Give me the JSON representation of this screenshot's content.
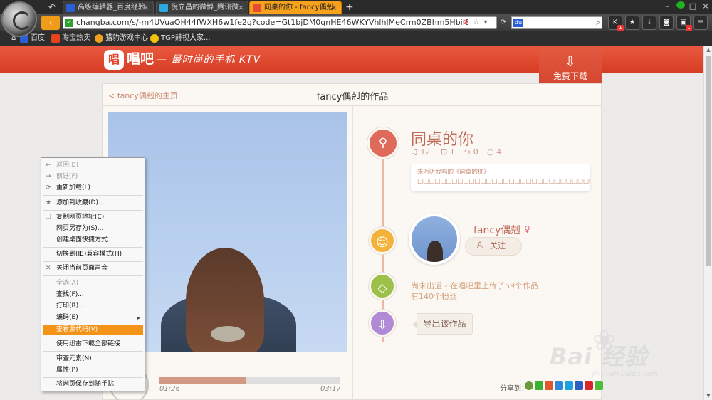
{
  "browser": {
    "tabs": [
      {
        "label": "高级编辑器_百度经验",
        "active": false
      },
      {
        "label": "倪立昌的微博_腾讯微...",
        "active": false
      },
      {
        "label": "同桌的你 - fancy偶剋",
        "active": true
      }
    ],
    "new_tab_icon": "+",
    "url": "changba.com/s/-m4UVuaOH44fWXH6w1fe2g?code=Gt1bjDM0qnHE46WKYVhlhJMeCrm0ZBhm5HbiI8KM4cUT",
    "bookmarks": [
      "百度",
      "淘宝热卖",
      "猎豹游戏中心",
      "TGP赫视大家..."
    ],
    "badge_count": "1"
  },
  "site": {
    "brand_logo": "唱",
    "brand_name": "唱吧",
    "slogan": "— 最时尚的手机 KTV",
    "download_label": "免费下载"
  },
  "card": {
    "home_link": "< fancy偶剋的主页",
    "title": "fancy偶剋的作品"
  },
  "song": {
    "title": "同桌的你",
    "listens": "12",
    "gifts": "1",
    "shares": "0",
    "comments": "4",
    "message": "来听听我唱的《同桌的你》, □□□□□□□□□□□□□□□□□□□□□□□□□□□□□□□□□□□□□□□□□□□□□□"
  },
  "user": {
    "name": "fancy偶剋",
    "gender_icon": "♀",
    "follow_label": "关注",
    "line1": "尚未出道 - 在唱吧里上传了59个作品",
    "line2": "有140个粉丝"
  },
  "export_label": "导出该作品",
  "player": {
    "current_time": "01:26",
    "total_time": "03:17",
    "progress": 0.48
  },
  "share_label": "分享到：",
  "watermark": {
    "brand": "Bai 经验",
    "url": "jingyan.baidu.com"
  },
  "context_menu": {
    "items": [
      {
        "label": "返回(B)",
        "disabled": true
      },
      {
        "label": "前进(F)",
        "disabled": true
      },
      {
        "label": "重新加载(L)",
        "disabled": false
      },
      {
        "label": "添加到收藏(D)...",
        "disabled": false
      },
      {
        "label": "复制网页地址(C)",
        "disabled": false
      },
      {
        "label": "网页另存为(S)...",
        "disabled": false
      },
      {
        "label": "创建桌面快捷方式",
        "disabled": false
      },
      {
        "label": "切换到(IE)兼容模式(H)",
        "disabled": false
      },
      {
        "label": "关闭当前页面声音",
        "disabled": false
      },
      {
        "label": "全选(A)",
        "disabled": true
      },
      {
        "label": "查找(F)...",
        "disabled": false
      },
      {
        "label": "打印(R)...",
        "disabled": false
      },
      {
        "label": "编码(E)",
        "disabled": false
      },
      {
        "label": "查看源代码(V)",
        "disabled": false,
        "highlighted": true
      },
      {
        "label": "使用迅雷下载全部链接",
        "disabled": false
      },
      {
        "label": "审查元素(N)",
        "disabled": false
      },
      {
        "label": "属性(P)",
        "disabled": false
      },
      {
        "label": "将网页保存到随手贴",
        "disabled": false
      }
    ]
  },
  "colors": {
    "header_red": "#d63d24",
    "accent_orange": "#f39418",
    "timeline_song": "#e06a5a",
    "timeline_user": "#f3b23a",
    "timeline_profile": "#9cc04a",
    "timeline_export": "#b18ad6"
  }
}
